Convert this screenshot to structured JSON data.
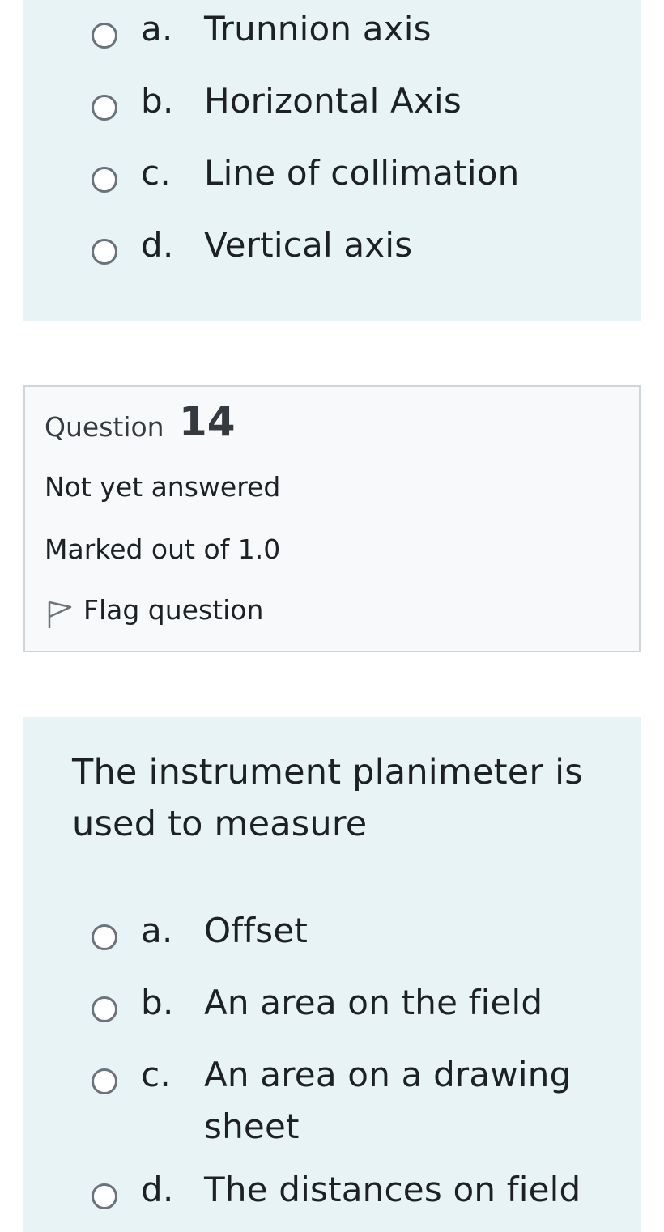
{
  "previous_question": {
    "options": [
      {
        "letter": "a.",
        "text": "Trunnion axis"
      },
      {
        "letter": "b.",
        "text": "Horizontal Axis"
      },
      {
        "letter": "c.",
        "text": "Line of collimation"
      },
      {
        "letter": "d.",
        "text": "Vertical axis"
      }
    ]
  },
  "question14": {
    "label": "Question",
    "number": "14",
    "status": "Not yet answered",
    "marks": "Marked out of 1.0",
    "flag_label": "Flag question",
    "flag_icon": "flag-outline-icon",
    "text": "The instrument planimeter is used to measure",
    "options": [
      {
        "letter": "a.",
        "text": "Offset"
      },
      {
        "letter": "b.",
        "text": "An area on the field"
      },
      {
        "letter": "c.",
        "text": "An area on a drawing sheet"
      },
      {
        "letter": "d.",
        "text": "The distances on field"
      }
    ]
  },
  "colors": {
    "answer_panel_bg": "#e7f3f5",
    "info_box_bg": "#f7f9fa",
    "info_box_border": "#cfd5d9",
    "radio_border": "#6a737b",
    "text": "#1d2125"
  }
}
